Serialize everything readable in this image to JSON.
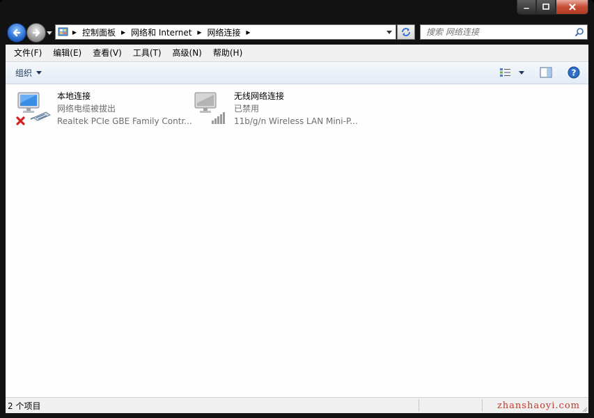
{
  "window": {
    "caption_buttons": [
      "minimize-icon",
      "maximize-icon",
      "close-icon"
    ]
  },
  "navigation": {
    "back_icon": "back-arrow-icon",
    "forward_icon": "forward-arrow-icon",
    "breadcrumb": [
      "控制面板",
      "网络和 Internet",
      "网络连接"
    ],
    "search_placeholder": "搜索 网络连接"
  },
  "menubar": {
    "items": [
      "文件(F)",
      "编辑(E)",
      "查看(V)",
      "工具(T)",
      "高级(N)",
      "帮助(H)"
    ]
  },
  "toolbar": {
    "organize_label": "组织"
  },
  "connections": [
    {
      "name": "本地连接",
      "status": "网络电缆被拔出",
      "device": "Realtek PCIe GBE Family Contr...",
      "icon": "wired-network-disconnected-icon"
    },
    {
      "name": "无线网络连接",
      "status": "已禁用",
      "device": "11b/g/n  Wireless LAN Mini-P...",
      "icon": "wireless-network-disabled-icon"
    }
  ],
  "statusbar": {
    "count_text": "2 个项目",
    "watermark": "zhanshaoyi.com"
  },
  "colors": {
    "accent_blue": "#2a6bd1",
    "close_red": "#c74c35",
    "watermark_red": "#c0392b"
  }
}
